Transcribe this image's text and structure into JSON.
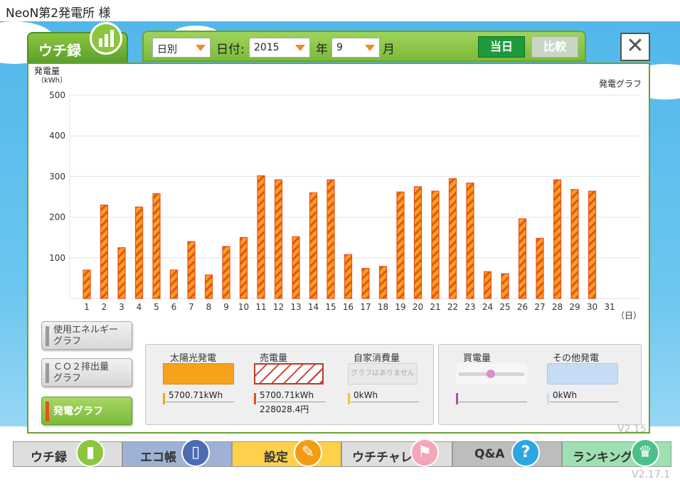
{
  "window": {
    "title": "NeoN第2発電所  様"
  },
  "tab": {
    "label": "ウチ録"
  },
  "toolbar": {
    "period": "日別",
    "date_label": "日付:",
    "year": "2015",
    "year_label": "年",
    "month": "9",
    "month_label": "月",
    "today_label": "当日",
    "compare_label": "比較"
  },
  "close": {
    "label": "✕"
  },
  "chart_data": {
    "type": "bar",
    "title": "発電グラフ",
    "ylabel": "発電量",
    "yunit": "（kWh）",
    "xunit": "（日）",
    "ylim": [
      0,
      500
    ],
    "yticks": [
      100,
      200,
      300,
      400,
      500
    ],
    "categories": [
      "1",
      "2",
      "3",
      "4",
      "5",
      "6",
      "7",
      "8",
      "9",
      "10",
      "11",
      "12",
      "13",
      "14",
      "15",
      "16",
      "17",
      "18",
      "19",
      "20",
      "21",
      "22",
      "23",
      "24",
      "25",
      "26",
      "27",
      "28",
      "29",
      "30",
      "31"
    ],
    "values": [
      70,
      230,
      125,
      225,
      258,
      70,
      140,
      58,
      128,
      150,
      302,
      292,
      152,
      260,
      292,
      108,
      74,
      79,
      262,
      275,
      264,
      295,
      284,
      66,
      61,
      196,
      148,
      292,
      268,
      264,
      null
    ],
    "bar_fill": "#f7a21b",
    "bar_stripe": "#e8501e"
  },
  "side_buttons": [
    {
      "label1": "使用エネルギー",
      "label2": "グラフ"
    },
    {
      "label1": "ＣＯ２排出量",
      "label2": "グラフ"
    },
    {
      "label1": "発電グラフ"
    }
  ],
  "legend": {
    "solar": {
      "title": "太陽光発電",
      "value": "5700.71kWh",
      "color": "#f7a21b"
    },
    "sold": {
      "title": "売電量",
      "value": "5700.71kWh",
      "value2": "228028.4円"
    },
    "self": {
      "title": "自家消費量",
      "note": "グラフはありません",
      "value": "0kWh"
    },
    "bought": {
      "title": "買電量"
    },
    "other": {
      "title": "その他発電",
      "value": "0kWh"
    }
  },
  "nav": {
    "uchiroku": "ウチ録",
    "ecocho": "エコ帳",
    "settings": "設定",
    "uchichalle": "ウチチャレ",
    "qa": "Q&A",
    "ranking": "ランキング"
  },
  "version": {
    "inner": "V2.15",
    "outer": "V2.17.1"
  },
  "colors": {
    "accent_green": "#7cbb3a",
    "today_green": "#1e9a3c",
    "bar_orange": "#f7a21b",
    "stripe_red": "#e8501e"
  }
}
